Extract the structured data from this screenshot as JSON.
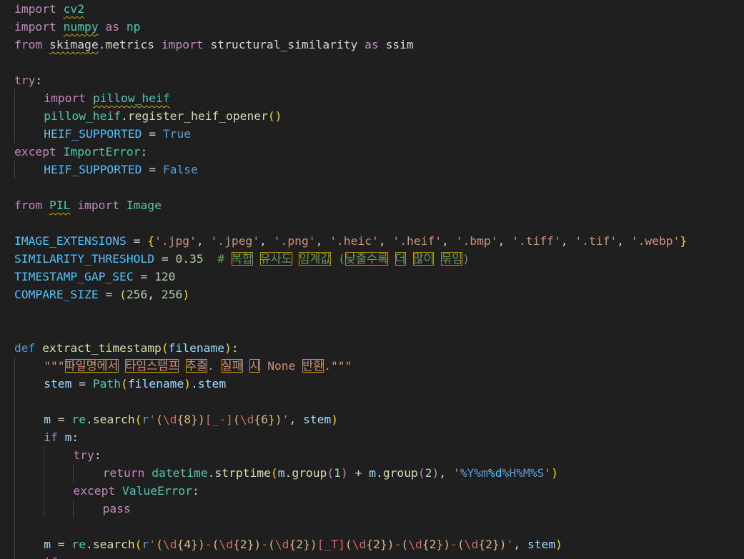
{
  "colors": {
    "background": "#1f1f1f",
    "keyword_control": "#c586c0",
    "module": "#4ec9b0",
    "function": "#dcdcaa",
    "variable": "#9cdcfe",
    "constant": "#4fc1ff",
    "boolean": "#569cd6",
    "number": "#b5cea8",
    "string": "#ce9178",
    "comment": "#6a9955",
    "plain": "#d4d4d4",
    "brace": "#ffd700",
    "regex": "#d16969",
    "escape": "#d7ba7d"
  },
  "code_lines": [
    {
      "indent": 0,
      "tokens": [
        {
          "t": "import ",
          "c": "keyword_control"
        },
        {
          "t": "cv2",
          "c": "module",
          "s": 1
        }
      ]
    },
    {
      "indent": 0,
      "tokens": [
        {
          "t": "import ",
          "c": "keyword_control"
        },
        {
          "t": "numpy",
          "c": "module",
          "s": 1
        },
        {
          "t": " as ",
          "c": "keyword_control"
        },
        {
          "t": "np",
          "c": "module"
        }
      ]
    },
    {
      "indent": 0,
      "tokens": [
        {
          "t": "from ",
          "c": "keyword_control"
        },
        {
          "t": "skimage",
          "c": "plain",
          "s": 1
        },
        {
          "t": ".",
          "c": "plain"
        },
        {
          "t": "metrics",
          "c": "plain"
        },
        {
          "t": " import ",
          "c": "keyword_control"
        },
        {
          "t": "structural_similarity",
          "c": "plain"
        },
        {
          "t": " as ",
          "c": "keyword_control"
        },
        {
          "t": "ssim",
          "c": "plain"
        }
      ]
    },
    {
      "indent": 0,
      "tokens": []
    },
    {
      "indent": 0,
      "tokens": [
        {
          "t": "try",
          "c": "keyword_control"
        },
        {
          "t": ":",
          "c": "plain"
        }
      ]
    },
    {
      "indent": 1,
      "tokens": [
        {
          "t": "import ",
          "c": "keyword_control"
        },
        {
          "t": "pillow_heif",
          "c": "module",
          "s": 1
        }
      ]
    },
    {
      "indent": 1,
      "tokens": [
        {
          "t": "pillow_heif",
          "c": "module"
        },
        {
          "t": ".",
          "c": "plain"
        },
        {
          "t": "register_heif_opener",
          "c": "function"
        },
        {
          "t": "()",
          "c": "brace"
        }
      ]
    },
    {
      "indent": 1,
      "tokens": [
        {
          "t": "HEIF_SUPPORTED",
          "c": "constant"
        },
        {
          "t": " = ",
          "c": "plain"
        },
        {
          "t": "True",
          "c": "boolean"
        }
      ]
    },
    {
      "indent": 0,
      "tokens": [
        {
          "t": "except ",
          "c": "keyword_control"
        },
        {
          "t": "ImportError",
          "c": "module"
        },
        {
          "t": ":",
          "c": "plain"
        }
      ]
    },
    {
      "indent": 1,
      "tokens": [
        {
          "t": "HEIF_SUPPORTED",
          "c": "constant"
        },
        {
          "t": " = ",
          "c": "plain"
        },
        {
          "t": "False",
          "c": "boolean"
        }
      ]
    },
    {
      "indent": 0,
      "tokens": []
    },
    {
      "indent": 0,
      "tokens": [
        {
          "t": "from ",
          "c": "keyword_control"
        },
        {
          "t": "PIL",
          "c": "module",
          "s": 1
        },
        {
          "t": " import ",
          "c": "keyword_control"
        },
        {
          "t": "Image",
          "c": "module"
        }
      ]
    },
    {
      "indent": 0,
      "tokens": []
    },
    {
      "indent": 0,
      "tokens": [
        {
          "t": "IMAGE_EXTENSIONS",
          "c": "constant"
        },
        {
          "t": " = ",
          "c": "plain"
        },
        {
          "t": "{",
          "c": "brace"
        },
        {
          "t": "'.jpg'",
          "c": "string"
        },
        {
          "t": ", ",
          "c": "plain"
        },
        {
          "t": "'.jpeg'",
          "c": "string"
        },
        {
          "t": ", ",
          "c": "plain"
        },
        {
          "t": "'.png'",
          "c": "string"
        },
        {
          "t": ", ",
          "c": "plain"
        },
        {
          "t": "'.heic'",
          "c": "string"
        },
        {
          "t": ", ",
          "c": "plain"
        },
        {
          "t": "'.heif'",
          "c": "string"
        },
        {
          "t": ", ",
          "c": "plain"
        },
        {
          "t": "'.bmp'",
          "c": "string"
        },
        {
          "t": ", ",
          "c": "plain"
        },
        {
          "t": "'.tiff'",
          "c": "string"
        },
        {
          "t": ", ",
          "c": "plain"
        },
        {
          "t": "'.tif'",
          "c": "string"
        },
        {
          "t": ", ",
          "c": "plain"
        },
        {
          "t": "'.webp'",
          "c": "string"
        },
        {
          "t": "}",
          "c": "brace"
        }
      ]
    },
    {
      "indent": 0,
      "tokens": [
        {
          "t": "SIMILARITY_THRESHOLD",
          "c": "constant"
        },
        {
          "t": " = ",
          "c": "plain"
        },
        {
          "t": "0.35",
          "c": "number"
        },
        {
          "t": "  # ",
          "c": "comment"
        },
        {
          "t": "복합",
          "c": "comment",
          "h": 1
        },
        {
          "t": " ",
          "c": "comment"
        },
        {
          "t": "유사도",
          "c": "comment",
          "h": 1
        },
        {
          "t": " ",
          "c": "comment"
        },
        {
          "t": "임계값",
          "c": "comment",
          "h": 1
        },
        {
          "t": " (",
          "c": "comment"
        },
        {
          "t": "낮출수록",
          "c": "comment",
          "h": 1
        },
        {
          "t": " ",
          "c": "comment"
        },
        {
          "t": "더",
          "c": "comment",
          "h": 1
        },
        {
          "t": " ",
          "c": "comment"
        },
        {
          "t": "많이",
          "c": "comment",
          "h": 1
        },
        {
          "t": " ",
          "c": "comment"
        },
        {
          "t": "묶임",
          "c": "comment",
          "h": 1
        },
        {
          "t": ")",
          "c": "comment"
        }
      ]
    },
    {
      "indent": 0,
      "tokens": [
        {
          "t": "TIMESTAMP_GAP_SEC",
          "c": "constant"
        },
        {
          "t": " = ",
          "c": "plain"
        },
        {
          "t": "120",
          "c": "number"
        }
      ]
    },
    {
      "indent": 0,
      "tokens": [
        {
          "t": "COMPARE_SIZE",
          "c": "constant"
        },
        {
          "t": " = ",
          "c": "plain"
        },
        {
          "t": "(",
          "c": "brace"
        },
        {
          "t": "256",
          "c": "number"
        },
        {
          "t": ", ",
          "c": "plain"
        },
        {
          "t": "256",
          "c": "number"
        },
        {
          "t": ")",
          "c": "brace"
        }
      ]
    },
    {
      "indent": 0,
      "tokens": []
    },
    {
      "indent": 0,
      "tokens": []
    },
    {
      "indent": 0,
      "tokens": [
        {
          "t": "def ",
          "c": "boolean"
        },
        {
          "t": "extract_timestamp",
          "c": "function"
        },
        {
          "t": "(",
          "c": "brace"
        },
        {
          "t": "filename",
          "c": "variable"
        },
        {
          "t": ")",
          "c": "brace"
        },
        {
          "t": ":",
          "c": "plain"
        }
      ]
    },
    {
      "indent": 1,
      "tokens": [
        {
          "t": "\"\"\"",
          "c": "string"
        },
        {
          "t": "파일명에서",
          "c": "string",
          "h": 1
        },
        {
          "t": " ",
          "c": "string"
        },
        {
          "t": "타임스탬프",
          "c": "string",
          "h": 1
        },
        {
          "t": " ",
          "c": "string"
        },
        {
          "t": "추출",
          "c": "string",
          "h": 1
        },
        {
          "t": ". ",
          "c": "string"
        },
        {
          "t": "실패",
          "c": "string",
          "h": 1
        },
        {
          "t": " ",
          "c": "string"
        },
        {
          "t": "시",
          "c": "string",
          "h": 1
        },
        {
          "t": " None ",
          "c": "string"
        },
        {
          "t": "반환",
          "c": "string",
          "h": 1
        },
        {
          "t": ".\"\"\"",
          "c": "string"
        }
      ]
    },
    {
      "indent": 1,
      "tokens": [
        {
          "t": "stem",
          "c": "variable"
        },
        {
          "t": " = ",
          "c": "plain"
        },
        {
          "t": "Path",
          "c": "module"
        },
        {
          "t": "(",
          "c": "brace"
        },
        {
          "t": "filename",
          "c": "variable"
        },
        {
          "t": ")",
          "c": "brace"
        },
        {
          "t": ".",
          "c": "plain"
        },
        {
          "t": "stem",
          "c": "variable"
        }
      ]
    },
    {
      "indent": 1,
      "tokens": []
    },
    {
      "indent": 1,
      "tokens": [
        {
          "t": "m",
          "c": "variable"
        },
        {
          "t": " = ",
          "c": "plain"
        },
        {
          "t": "re",
          "c": "module"
        },
        {
          "t": ".",
          "c": "plain"
        },
        {
          "t": "search",
          "c": "function"
        },
        {
          "t": "(",
          "c": "brace"
        },
        {
          "t": "r",
          "c": "boolean"
        },
        {
          "t": "'",
          "c": "regex"
        },
        {
          "t": "(",
          "c": "escape"
        },
        {
          "t": "\\d",
          "c": "regex"
        },
        {
          "t": "{8}",
          "c": "escape"
        },
        {
          "t": ")",
          "c": "escape"
        },
        {
          "t": "[_-]",
          "c": "regex"
        },
        {
          "t": "(",
          "c": "escape"
        },
        {
          "t": "\\d",
          "c": "regex"
        },
        {
          "t": "{6}",
          "c": "escape"
        },
        {
          "t": ")",
          "c": "escape"
        },
        {
          "t": "'",
          "c": "regex"
        },
        {
          "t": ", ",
          "c": "plain"
        },
        {
          "t": "stem",
          "c": "variable"
        },
        {
          "t": ")",
          "c": "brace"
        }
      ]
    },
    {
      "indent": 1,
      "tokens": [
        {
          "t": "if ",
          "c": "keyword_control"
        },
        {
          "t": "m",
          "c": "variable"
        },
        {
          "t": ":",
          "c": "plain"
        }
      ]
    },
    {
      "indent": 2,
      "tokens": [
        {
          "t": "try",
          "c": "keyword_control"
        },
        {
          "t": ":",
          "c": "plain"
        }
      ]
    },
    {
      "indent": 3,
      "tokens": [
        {
          "t": "return ",
          "c": "keyword_control"
        },
        {
          "t": "datetime",
          "c": "module"
        },
        {
          "t": ".",
          "c": "plain"
        },
        {
          "t": "strptime",
          "c": "function"
        },
        {
          "t": "(",
          "c": "brace"
        },
        {
          "t": "m",
          "c": "variable"
        },
        {
          "t": ".",
          "c": "plain"
        },
        {
          "t": "group",
          "c": "function"
        },
        {
          "t": "(",
          "c": "keyword_control"
        },
        {
          "t": "1",
          "c": "number"
        },
        {
          "t": ")",
          "c": "keyword_control"
        },
        {
          "t": " + ",
          "c": "plain"
        },
        {
          "t": "m",
          "c": "variable"
        },
        {
          "t": ".",
          "c": "plain"
        },
        {
          "t": "group",
          "c": "function"
        },
        {
          "t": "(",
          "c": "keyword_control"
        },
        {
          "t": "2",
          "c": "number"
        },
        {
          "t": ")",
          "c": "keyword_control"
        },
        {
          "t": ", ",
          "c": "plain"
        },
        {
          "t": "'",
          "c": "string"
        },
        {
          "t": "%Y%m",
          "c": "boolean"
        },
        {
          "t": "%d",
          "c": "constant"
        },
        {
          "t": "%H%M%S",
          "c": "boolean"
        },
        {
          "t": "'",
          "c": "string"
        },
        {
          "t": ")",
          "c": "brace"
        }
      ]
    },
    {
      "indent": 2,
      "tokens": [
        {
          "t": "except ",
          "c": "keyword_control"
        },
        {
          "t": "ValueError",
          "c": "module"
        },
        {
          "t": ":",
          "c": "plain"
        }
      ]
    },
    {
      "indent": 3,
      "tokens": [
        {
          "t": "pass",
          "c": "keyword_control"
        }
      ]
    },
    {
      "indent": 1,
      "tokens": []
    },
    {
      "indent": 1,
      "tokens": [
        {
          "t": "m",
          "c": "variable"
        },
        {
          "t": " = ",
          "c": "plain"
        },
        {
          "t": "re",
          "c": "module"
        },
        {
          "t": ".",
          "c": "plain"
        },
        {
          "t": "search",
          "c": "function"
        },
        {
          "t": "(",
          "c": "brace"
        },
        {
          "t": "r",
          "c": "boolean"
        },
        {
          "t": "'",
          "c": "regex"
        },
        {
          "t": "(",
          "c": "escape"
        },
        {
          "t": "\\d",
          "c": "regex"
        },
        {
          "t": "{4}",
          "c": "escape"
        },
        {
          "t": ")",
          "c": "escape"
        },
        {
          "t": "-",
          "c": "regex"
        },
        {
          "t": "(",
          "c": "escape"
        },
        {
          "t": "\\d",
          "c": "regex"
        },
        {
          "t": "{2}",
          "c": "escape"
        },
        {
          "t": ")",
          "c": "escape"
        },
        {
          "t": "-",
          "c": "regex"
        },
        {
          "t": "(",
          "c": "escape"
        },
        {
          "t": "\\d",
          "c": "regex"
        },
        {
          "t": "{2}",
          "c": "escape"
        },
        {
          "t": ")",
          "c": "escape"
        },
        {
          "t": "[_T]",
          "c": "regex"
        },
        {
          "t": "(",
          "c": "escape"
        },
        {
          "t": "\\d",
          "c": "regex"
        },
        {
          "t": "{2}",
          "c": "escape"
        },
        {
          "t": ")",
          "c": "escape"
        },
        {
          "t": "-",
          "c": "regex"
        },
        {
          "t": "(",
          "c": "escape"
        },
        {
          "t": "\\d",
          "c": "regex"
        },
        {
          "t": "{2}",
          "c": "escape"
        },
        {
          "t": ")",
          "c": "escape"
        },
        {
          "t": "-",
          "c": "regex"
        },
        {
          "t": "(",
          "c": "escape"
        },
        {
          "t": "\\d",
          "c": "regex"
        },
        {
          "t": "{2}",
          "c": "escape"
        },
        {
          "t": ")",
          "c": "escape"
        },
        {
          "t": "'",
          "c": "regex"
        },
        {
          "t": ", ",
          "c": "plain"
        },
        {
          "t": "stem",
          "c": "variable"
        },
        {
          "t": ")",
          "c": "brace"
        }
      ]
    },
    {
      "indent": 1,
      "tokens": [
        {
          "t": "if",
          "c": "keyword_control"
        }
      ]
    }
  ]
}
